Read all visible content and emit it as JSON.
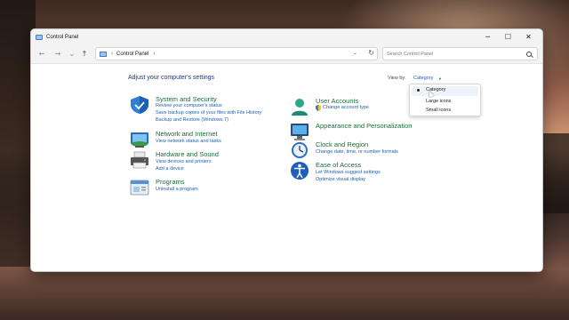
{
  "window": {
    "title": "Control Panel",
    "controls": {
      "minimize": "─",
      "maximize": "☐",
      "close": "✕"
    }
  },
  "nav": {
    "back": "←",
    "forward": "→",
    "history": "⌄",
    "up": "↑",
    "address_sep": "›",
    "address_text": "Control Panel",
    "address_sep2": "›",
    "address_drop": "⌄",
    "refresh": "↻",
    "search_placeholder": "Search Control Panel"
  },
  "main": {
    "heading": "Adjust your computer's settings",
    "view_by_label": "View by:",
    "view_by_value": "Category",
    "view_by_caret": "▼"
  },
  "categories_left": [
    {
      "title": "System and Security",
      "icon": "shield-icon",
      "links": [
        "Review your computer's status",
        "Save backup copies of your files with File History",
        "Backup and Restore (Windows 7)"
      ]
    },
    {
      "title": "Network and Internet",
      "icon": "network-icon",
      "links": [
        "View network status and tasks"
      ]
    },
    {
      "title": "Hardware and Sound",
      "icon": "printer-icon",
      "links": [
        "View devices and printers",
        "Add a device"
      ]
    },
    {
      "title": "Programs",
      "icon": "programs-icon",
      "links": [
        "Uninstall a program"
      ]
    }
  ],
  "categories_right": [
    {
      "title": "User Accounts",
      "icon": "user-icon",
      "links": [
        "Change account type"
      ]
    },
    {
      "title": "Appearance and Personalization",
      "icon": "monitor-icon",
      "links": []
    },
    {
      "title": "Clock and Region",
      "icon": "clock-icon",
      "links": [
        "Change date, time, or number formats"
      ]
    },
    {
      "title": "Ease of Access",
      "icon": "accessibility-icon",
      "links": [
        "Let Windows suggest settings",
        "Optimize visual display"
      ]
    }
  ],
  "dropdown": {
    "items": [
      "Category",
      "Large icons",
      "Small icons"
    ],
    "selected": "Category"
  },
  "colors": {
    "accent": "#1a5fb4",
    "category_title": "#1e6b3b",
    "heading": "#1e3287"
  }
}
